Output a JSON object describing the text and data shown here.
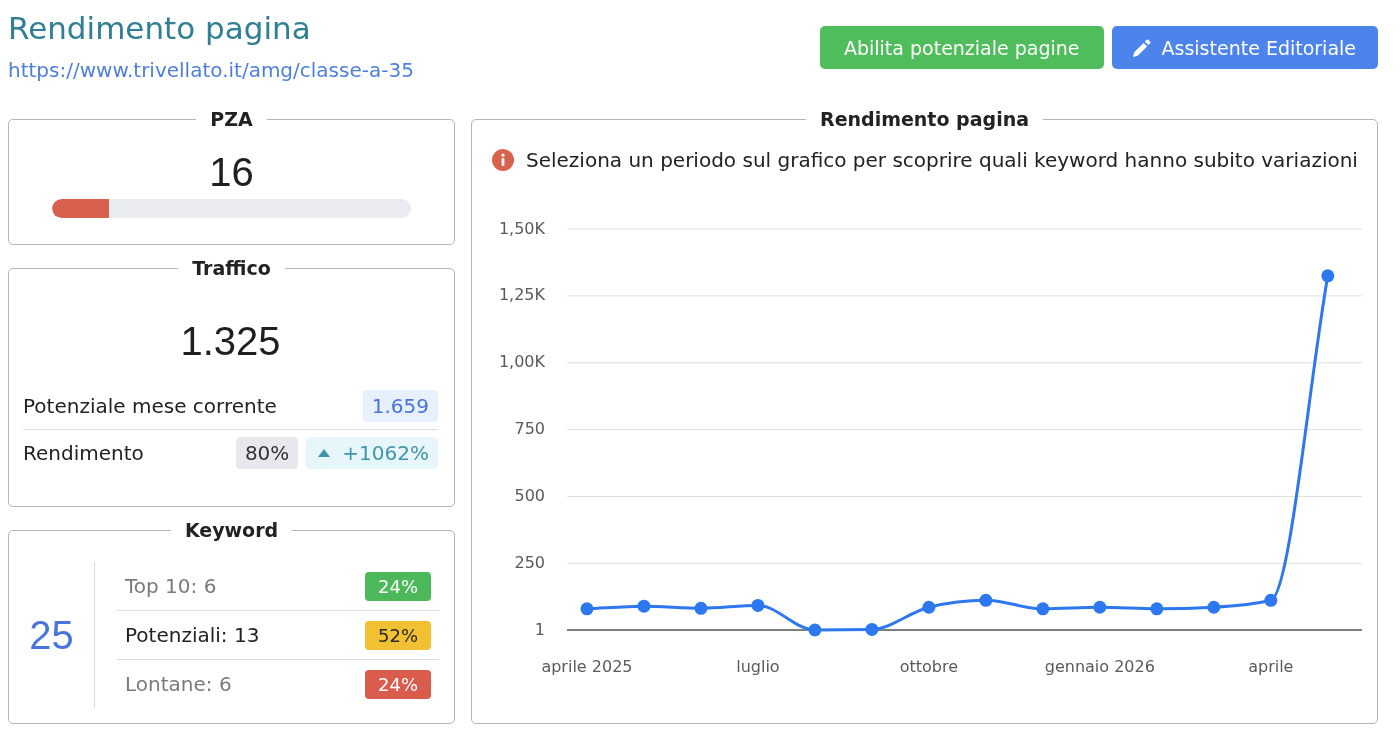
{
  "header": {
    "title": "Rendimento pagina",
    "url": "https://www.trivellato.it/amg/classe-a-35",
    "buttons": [
      {
        "label": "Abilita potenziale pagine",
        "kind": "success"
      },
      {
        "label": "Assistente Editoriale",
        "kind": "edit"
      }
    ]
  },
  "pza": {
    "title": "PZA",
    "value": "16",
    "level": 0.16
  },
  "traffic": {
    "title": "Traffico",
    "value": "1.325",
    "rows": [
      {
        "label": "Potenziale mese corrente",
        "badges": [
          {
            "text": "1.659",
            "kind": "info"
          }
        ]
      },
      {
        "label": "Rendimento",
        "badges": [
          {
            "text": "80%",
            "kind": "neutral"
          },
          {
            "text": "+1062%",
            "kind": "trend_up"
          }
        ]
      }
    ]
  },
  "keywords": {
    "title": "Keyword",
    "total": "25",
    "groups": [
      {
        "label": "Top 10: 6",
        "share": "24%",
        "color": "#4cb85a",
        "emphasized": false
      },
      {
        "label": "Potenziali: 13",
        "share": "52%",
        "color": "#f2c133",
        "emphasized": true
      },
      {
        "label": "Lontane: 6",
        "share": "24%",
        "color": "#d95c4c",
        "emphasized": false
      }
    ]
  },
  "performance": {
    "title": "Rendimento pagina",
    "notice": "Seleziona un periodo sul grafico per scoprire quali keyword hanno subito variazioni",
    "chart_data": {
      "type": "line",
      "categories": [
        "aprile 2025",
        null,
        null,
        "luglio",
        null,
        null,
        "ottobre",
        null,
        null,
        "gennaio 2026",
        null,
        null,
        "aprile",
        null
      ],
      "ylim": [
        1,
        1500
      ],
      "yticks": [
        {
          "value": 1,
          "label": "1"
        },
        {
          "value": 250,
          "label": "250"
        },
        {
          "value": 500,
          "label": "500"
        },
        {
          "value": 750,
          "label": "750"
        },
        {
          "value": 1000,
          "label": "1,00K"
        },
        {
          "value": 1250,
          "label": "1,25K"
        },
        {
          "value": 1500,
          "label": "1,50K"
        }
      ],
      "grid": true,
      "series": [
        {
          "color": "#2d78ee",
          "marker": "circle",
          "values": [
            80,
            90,
            82,
            93,
            1,
            3,
            86,
            112,
            80,
            86,
            80,
            86,
            112,
            1325
          ]
        }
      ]
    }
  }
}
